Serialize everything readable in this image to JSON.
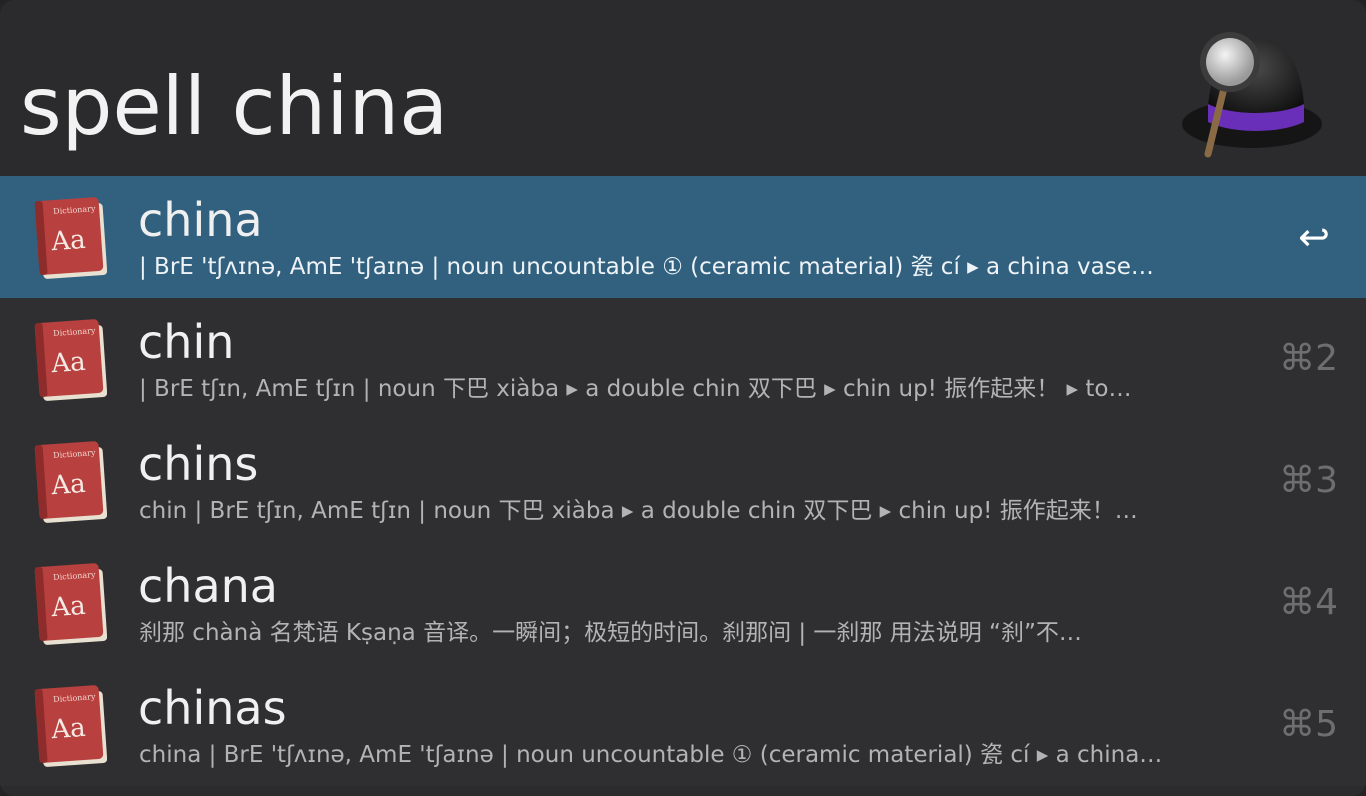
{
  "search": {
    "query": "spell china"
  },
  "results": [
    {
      "title": "china",
      "subtitle": "| BrE 'tʃʌɪnə, AmE 'tʃaɪnə | noun uncountable ① (ceramic material) 瓷 cí ▸ a china vase…",
      "shortcut": "↩",
      "selected": true
    },
    {
      "title": "chin",
      "subtitle": "| BrE tʃɪn, AmE tʃɪn | noun 下巴 xiàba ▸ a double chin 双下巴 ▸ chin up! 振作起来！ ▸ to…",
      "shortcut": "⌘2",
      "selected": false
    },
    {
      "title": "chins",
      "subtitle": "chin | BrE tʃɪn, AmE tʃɪn | noun 下巴 xiàba ▸ a double chin 双下巴 ▸ chin up! 振作起来！…",
      "shortcut": "⌘3",
      "selected": false
    },
    {
      "title": "chana",
      "subtitle": "刹那 chànà 名梵语 Kṣaṇa 音译。一瞬间；极短的时间。刹那间 | 一刹那 用法说明 “刹”不…",
      "shortcut": "⌘4",
      "selected": false
    },
    {
      "title": "chinas",
      "subtitle": "china | BrE 'tʃʌɪnə, AmE 'tʃaɪnə | noun uncountable ① (ceramic material) 瓷 cí ▸ a china…",
      "shortcut": "⌘5",
      "selected": false
    }
  ],
  "icons": {
    "dictionary_icon": "dictionary-book-icon",
    "dictionary_label_small": "Dictionary",
    "dictionary_label": "Aa",
    "app_logo": "alfred-hat-magnifier-logo"
  },
  "colors": {
    "selected_row": "#31617f",
    "row_background": "#2f2f31",
    "accent_purple": "#6a2fb8",
    "book_red": "#b8403e"
  }
}
